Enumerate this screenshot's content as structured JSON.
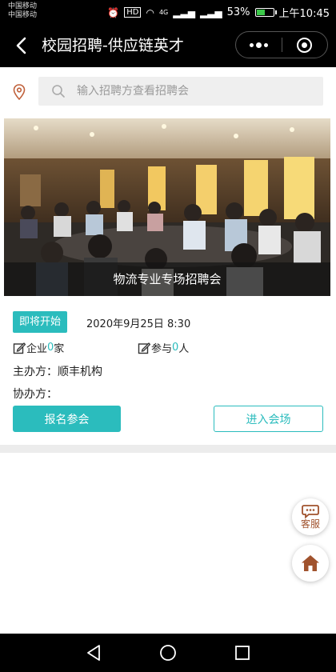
{
  "status_bar": {
    "carrier_1": "中国移动",
    "carrier_2": "中国移动",
    "hd_badge": "HD",
    "network": "4G",
    "battery": "53%",
    "battery_level": 0.53,
    "time": "上午10:45"
  },
  "header": {
    "title": "校园招聘-供应链英才",
    "icons": [
      "back-icon",
      "more-icon",
      "close-icon"
    ]
  },
  "search": {
    "placeholder": "输入招聘方查看招聘会",
    "icons": [
      "location-icon",
      "search-icon"
    ]
  },
  "banner": {
    "caption": "物流专业专场招聘会"
  },
  "event": {
    "status": "即将开始",
    "date": "2020年9月25日 8:30",
    "companies_label": "企业",
    "companies_count": "0",
    "companies_unit": "家",
    "participants_label": "参与",
    "participants_count": "0",
    "participants_unit": "人",
    "organizer_label": "主办方：",
    "organizer": "顺丰机构",
    "co_organizer_label": "协办方：",
    "co_organizer": ""
  },
  "actions": {
    "join_label": "报名参会",
    "enter_label": "进入会场"
  },
  "floating": {
    "service_label": "客服",
    "home_icon": "home-icon"
  },
  "nav": {
    "icons": [
      "back-triangle-icon",
      "home-circle-icon",
      "recents-square-icon"
    ]
  },
  "colors": {
    "accent": "#2bbcbd",
    "float_icon": "#a0522d",
    "bar_bg": "#000000"
  }
}
